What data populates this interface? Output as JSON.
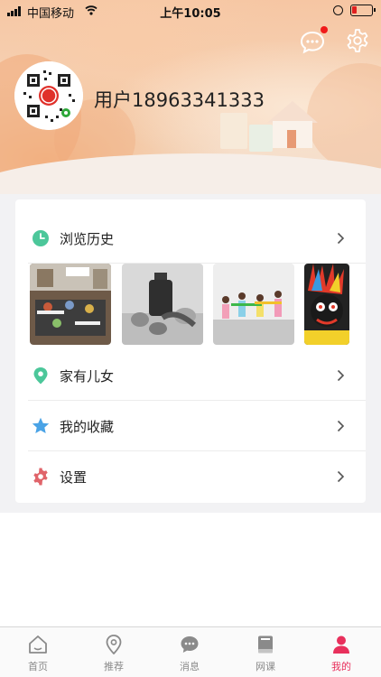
{
  "status_bar": {
    "carrier": "中国移动",
    "time": "上午10:05"
  },
  "header": {
    "username": "用户18963341333"
  },
  "menu": {
    "history_label": "浏览历史",
    "family_label": "家有儿女",
    "favorites_label": "我的收藏",
    "settings_label": "设置"
  },
  "colors": {
    "accent": "#e8305c",
    "history_icon": "#4cc79a",
    "location_icon": "#4cc79a",
    "star_icon": "#4aa3e6",
    "gear_icon": "#e0646a"
  },
  "tabbar": {
    "home": "首页",
    "recommend": "推荐",
    "messages": "消息",
    "online_course": "网课",
    "mine": "我的",
    "active": "mine"
  }
}
